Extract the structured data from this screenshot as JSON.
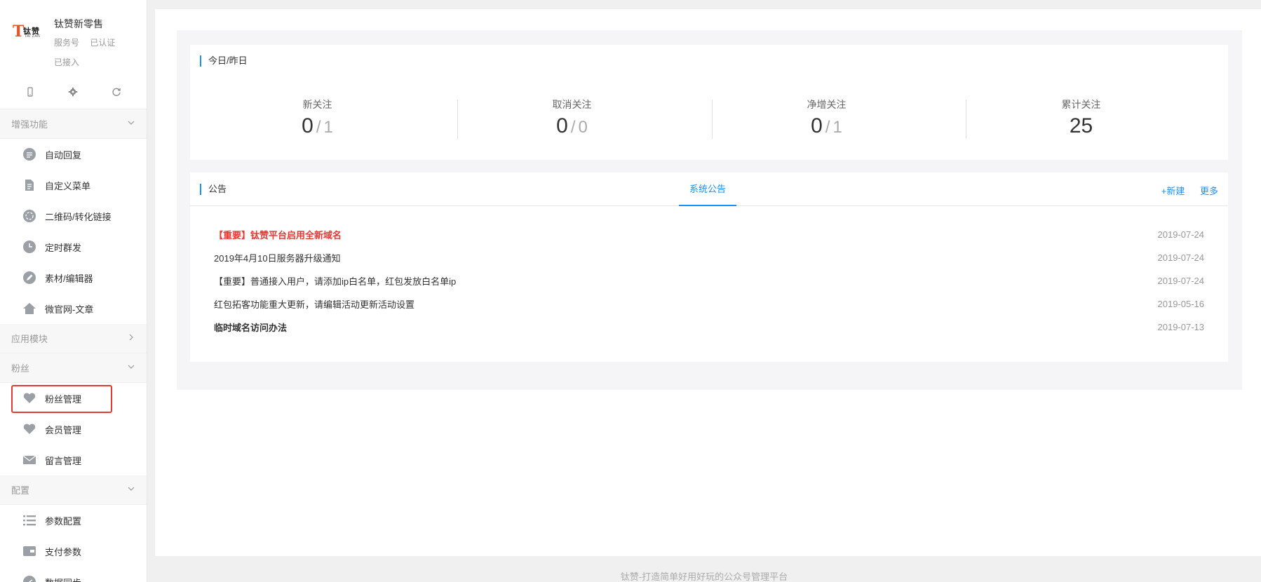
{
  "brand": {
    "logo_main": "T",
    "logo_cn": "钛赞",
    "logo_en": "TAI ZAN",
    "name": "钛赞新零售",
    "type": "服务号",
    "verified": "已认证",
    "status": "已接入"
  },
  "toolbar": {
    "icons": [
      "mobile-icon",
      "gear-icon",
      "refresh-icon"
    ]
  },
  "sidebar": {
    "groups": [
      {
        "label": "增强功能",
        "expanded": true,
        "items": [
          {
            "label": "自动回复",
            "icon": "chat-icon"
          },
          {
            "label": "自定义菜单",
            "icon": "document-icon"
          },
          {
            "label": "二维码/转化链接",
            "icon": "qrcode-icon"
          },
          {
            "label": "定时群发",
            "icon": "clock-icon"
          },
          {
            "label": "素材/编辑器",
            "icon": "pencil-icon"
          },
          {
            "label": "微官网-文章",
            "icon": "home-icon"
          }
        ]
      },
      {
        "label": "应用模块",
        "expanded": false,
        "items": []
      },
      {
        "label": "粉丝",
        "expanded": true,
        "items": [
          {
            "label": "粉丝管理",
            "icon": "heart-icon"
          },
          {
            "label": "会员管理",
            "icon": "heart-icon"
          },
          {
            "label": "留言管理",
            "icon": "mail-icon"
          }
        ]
      },
      {
        "label": "配置",
        "expanded": true,
        "items": [
          {
            "label": "参数配置",
            "icon": "list-icon"
          },
          {
            "label": "支付参数",
            "icon": "wallet-icon"
          },
          {
            "label": "数据同步",
            "icon": "sync-icon"
          }
        ]
      }
    ]
  },
  "stats": {
    "title": "今日/昨日",
    "separator": "/",
    "items": [
      {
        "label": "新关注",
        "today": "0",
        "yesterday": "1"
      },
      {
        "label": "取消关注",
        "today": "0",
        "yesterday": "0"
      },
      {
        "label": "净增关注",
        "today": "0",
        "yesterday": "1"
      },
      {
        "label": "累计关注",
        "total": "25"
      }
    ]
  },
  "notice": {
    "title": "公告",
    "active_tab": "系统公告",
    "new_label": "+新建",
    "more_label": "更多",
    "rows": [
      {
        "title": "【重要】钛赞平台启用全新域名",
        "date": "2019-07-24",
        "style": "red"
      },
      {
        "title": "2019年4月10日服务器升级通知",
        "date": "2019-07-24",
        "style": "normal"
      },
      {
        "title": "【重要】普通接入用户，请添加ip白名单，红包发放白名单ip",
        "date": "2019-07-24",
        "style": "normal"
      },
      {
        "title": "红包拓客功能重大更新，请编辑活动更新活动设置",
        "date": "2019-05-16",
        "style": "normal"
      },
      {
        "title": "临时域名访问办法",
        "date": "2019-07-13",
        "style": "bold"
      }
    ]
  },
  "footer": {
    "text": "钛赞-打造简单好用好玩的公众号管理平台"
  }
}
